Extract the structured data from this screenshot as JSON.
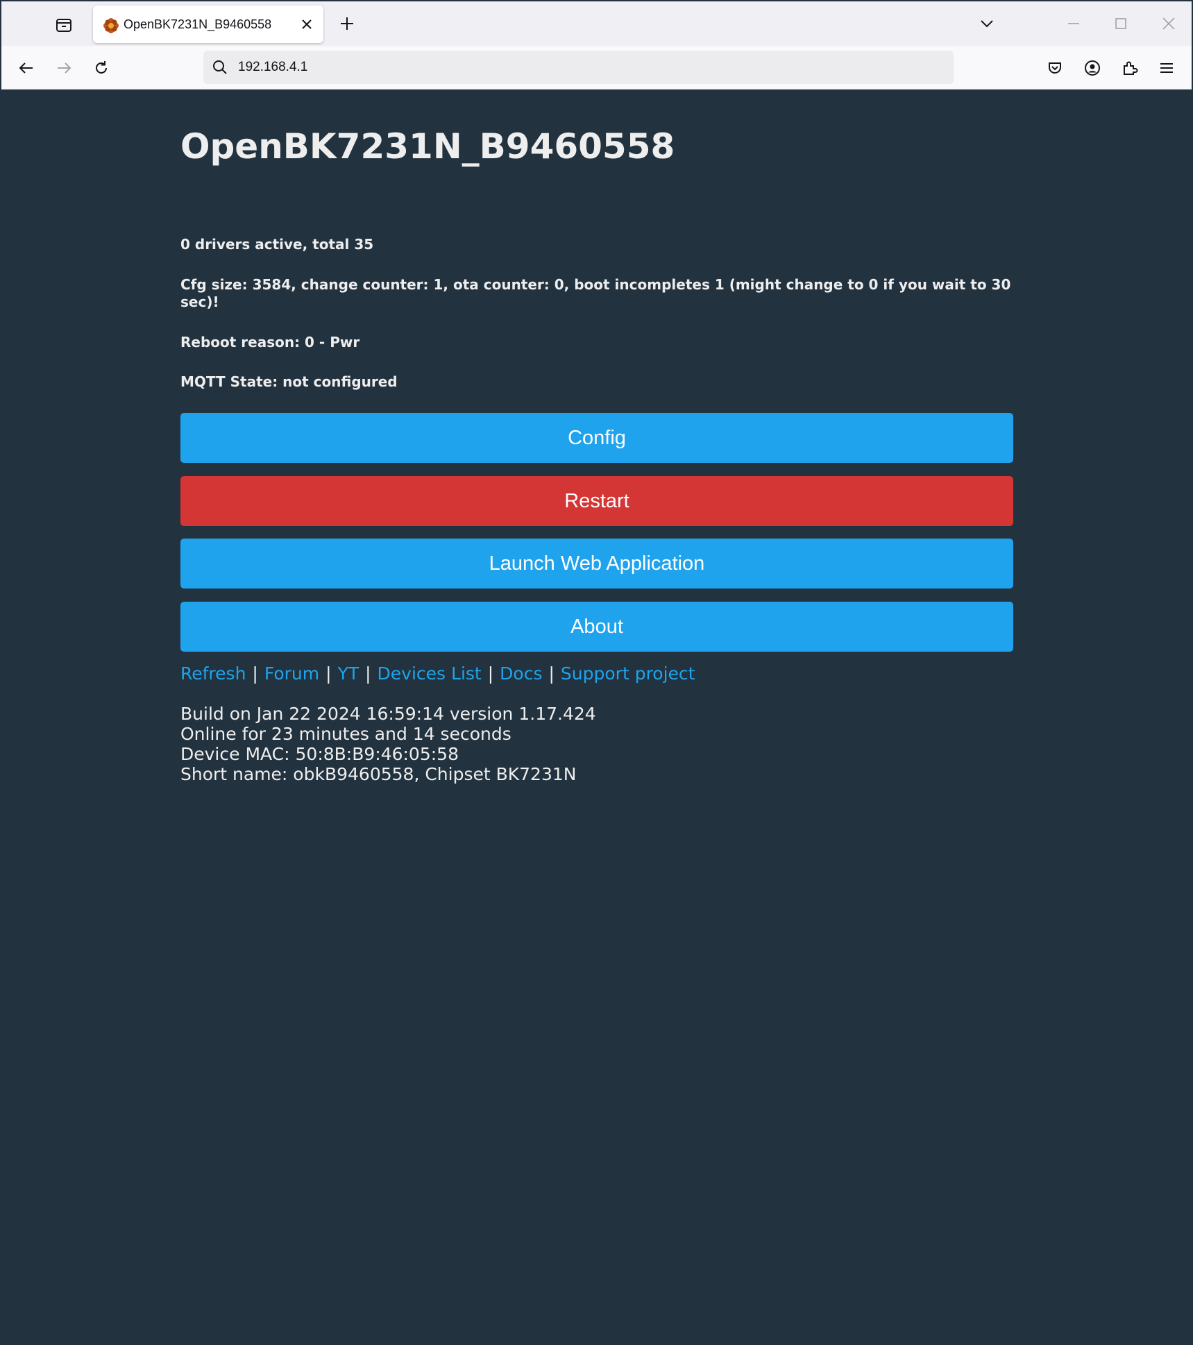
{
  "browser": {
    "tab": {
      "title": "OpenBK7231N_B9460558",
      "favicon": "flower-favicon-icon",
      "favicon_color": "#a0430e"
    },
    "url": "192.168.4.1",
    "icons": {
      "list_all_tabs": "list-all-tabs-icon",
      "new_tab": "plus-icon",
      "tab_overflow": "chevron-down-icon",
      "back": "back-arrow-icon",
      "forward": "forward-arrow-icon",
      "reload": "reload-icon",
      "search": "search-icon",
      "pocket": "pocket-icon",
      "account": "account-icon",
      "extensions": "extensions-icon",
      "menu": "hamburger-menu-icon"
    }
  },
  "page": {
    "title": "OpenBK7231N_B9460558",
    "status": [
      "0 drivers active, total 35",
      "Cfg size: 3584, change counter: 1, ota counter: 0, boot incompletes 1 (might change to 0 if you wait to 30 sec)!",
      "Reboot reason: 0 - Pwr",
      "MQTT State: not configured"
    ],
    "buttons": {
      "config": "Config",
      "restart": "Restart",
      "launch_web_app": "Launch Web Application",
      "about": "About"
    },
    "links": {
      "refresh": "Refresh",
      "forum": "Forum",
      "yt": "YT",
      "devices_list": "Devices List",
      "docs": "Docs",
      "support_project": "Support project",
      "separator": "|"
    },
    "info": {
      "build": "Build on Jan 22 2024 16:59:14 version 1.17.424",
      "online": "Online for 23 minutes and 14 seconds",
      "mac": "Device MAC: 50:8B:B9:46:05:58",
      "short_name": "Short name: obkB9460558, Chipset BK7231N"
    },
    "colors": {
      "background": "#22323f",
      "text": "#eeeeee",
      "button_blue": "#1fa3ec",
      "button_red": "#d43535",
      "link": "#1fa3ec"
    }
  }
}
